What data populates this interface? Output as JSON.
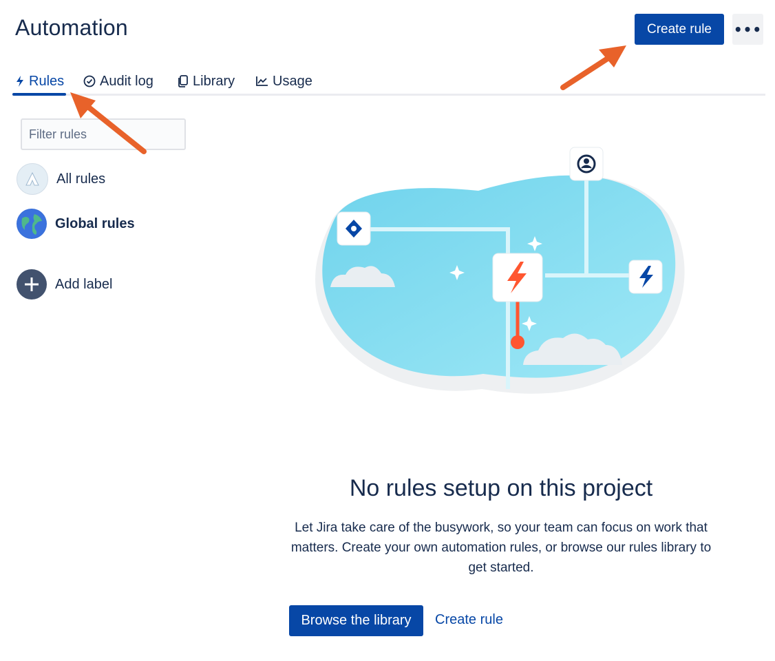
{
  "header": {
    "title": "Automation",
    "create_rule_label": "Create rule",
    "more_label": "•••"
  },
  "tabs": [
    {
      "label": "Rules",
      "icon": "lightning-icon",
      "active": true
    },
    {
      "label": "Audit log",
      "icon": "check-circle-icon",
      "active": false
    },
    {
      "label": "Library",
      "icon": "copy-icon",
      "active": false
    },
    {
      "label": "Usage",
      "icon": "chart-icon",
      "active": false
    }
  ],
  "sidebar": {
    "filter_placeholder": "Filter rules",
    "items": [
      {
        "label": "All rules",
        "icon": "atlassian-logo-icon"
      },
      {
        "label": "Global rules",
        "icon": "globe-icon"
      },
      {
        "label": "Add label",
        "icon": "plus-circle-icon"
      }
    ]
  },
  "empty_state": {
    "title": "No rules setup on this project",
    "text": "Let Jira take care of the busywork, so your team can focus on work that matters. Create your own automation rules, or browse our rules library to get started.",
    "browse_label": "Browse the library",
    "create_label": "Create rule"
  },
  "colors": {
    "primary": "#0747a6",
    "annotation_arrow": "#e8622a",
    "illustration_blob": "#79d9ef",
    "lightning_accent": "#ff5630"
  }
}
